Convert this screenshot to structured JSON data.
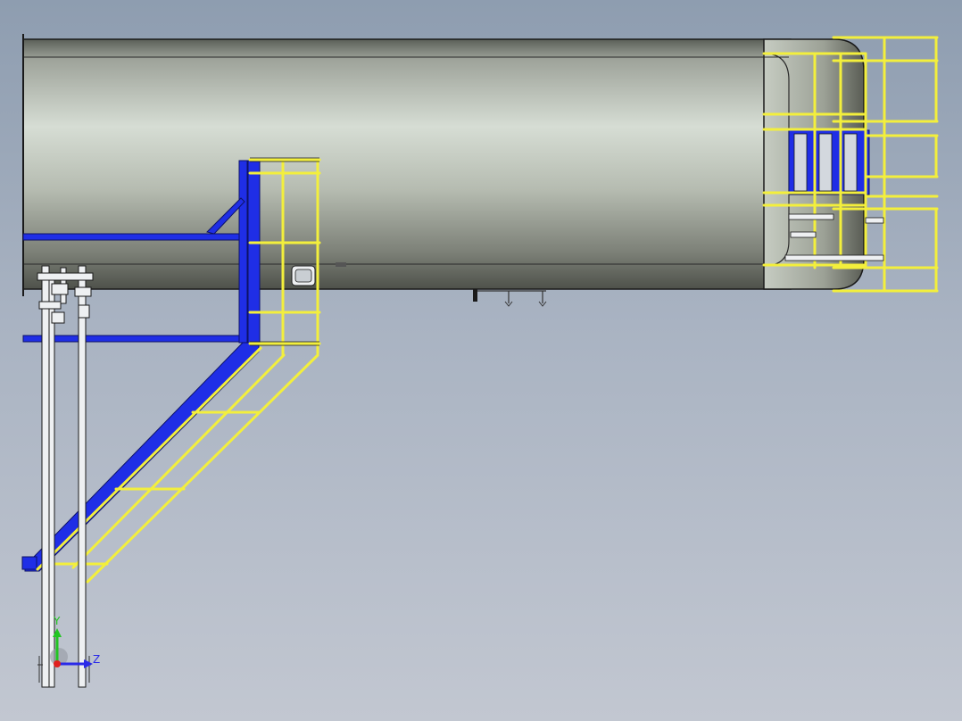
{
  "viewport": {
    "background_top": "#8e9db0",
    "background_bottom": "#c2c7d1"
  },
  "colors": {
    "vessel_light": "#d6ddd4",
    "vessel_dark": "#4e514a",
    "structure_blue": "#1f2ee6",
    "handrail_yellow": "#f3ef3c",
    "pipe_white": "#eef0f2",
    "outline": "#1a1a1a"
  },
  "triad": {
    "y_label": "Y",
    "z_label": "Z",
    "y_color": "#22c522",
    "z_color": "#2a2ae8",
    "x_color": "#e02020"
  }
}
